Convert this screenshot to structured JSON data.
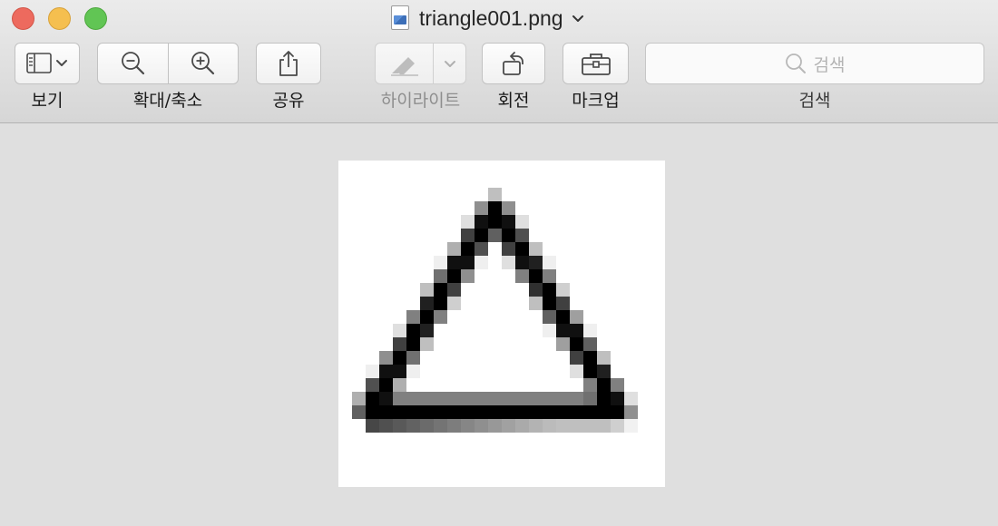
{
  "window": {
    "title": "triangle001.png",
    "app_icon": "png-document-icon"
  },
  "toolbar": {
    "view_label": "보기",
    "zoom_label": "확대/축소",
    "share_label": "공유",
    "highlight_label": "하이라이트",
    "rotate_label": "회전",
    "markup_label": "마크업",
    "search_label": "검색",
    "search_placeholder": "검색"
  },
  "image": {
    "filename": "triangle001.png",
    "content": "pixelated black triangle outline"
  },
  "colors": {
    "close": "#ed6a5e",
    "minimize": "#f5bf4f",
    "zoom": "#61c554",
    "background": "#dfdfdf"
  }
}
